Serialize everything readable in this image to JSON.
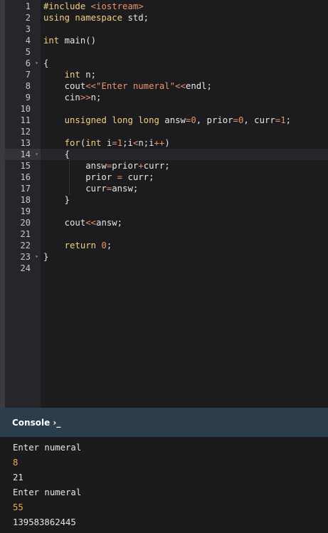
{
  "colors": {
    "keyword": "#f0d080",
    "type": "#f0d080",
    "preprocessor": "#f0d080",
    "include_target": "#e8956a",
    "operator": "#e8956a",
    "number": "#e8956a",
    "string": "#e8956a",
    "plain": "#e6e6e6",
    "console_input": "#e8b04a",
    "console_output": "#e6e6e6",
    "console_header_bg": "#2c3e4c"
  },
  "editor": {
    "active_line": 14,
    "fold_markers": [
      6,
      14,
      23
    ],
    "lines": [
      [
        [
          "preprocessor",
          "#include "
        ],
        [
          "include_target",
          "<iostream>"
        ]
      ],
      [
        [
          "keyword",
          "using namespace "
        ],
        [
          "plain",
          "std;"
        ]
      ],
      [],
      [
        [
          "type",
          "int "
        ],
        [
          "plain",
          "main()"
        ]
      ],
      [],
      [
        [
          "plain",
          "{"
        ]
      ],
      [
        [
          "plain",
          "    "
        ],
        [
          "type",
          "int "
        ],
        [
          "plain",
          "n;"
        ]
      ],
      [
        [
          "plain",
          "    cout"
        ],
        [
          "operator",
          "<<"
        ],
        [
          "string",
          "\"Enter numeral\""
        ],
        [
          "operator",
          "<<"
        ],
        [
          "plain",
          "endl;"
        ]
      ],
      [
        [
          "plain",
          "    cin"
        ],
        [
          "operator",
          ">>"
        ],
        [
          "plain",
          "n;"
        ]
      ],
      [],
      [
        [
          "plain",
          "    "
        ],
        [
          "type",
          "unsigned long long "
        ],
        [
          "plain",
          "answ"
        ],
        [
          "operator",
          "="
        ],
        [
          "number",
          "0"
        ],
        [
          "plain",
          ", prior"
        ],
        [
          "operator",
          "="
        ],
        [
          "number",
          "0"
        ],
        [
          "plain",
          ", curr"
        ],
        [
          "operator",
          "="
        ],
        [
          "number",
          "1"
        ],
        [
          "plain",
          ";"
        ]
      ],
      [],
      [
        [
          "plain",
          "    "
        ],
        [
          "keyword",
          "for"
        ],
        [
          "plain",
          "("
        ],
        [
          "type",
          "int "
        ],
        [
          "plain",
          "i"
        ],
        [
          "operator",
          "="
        ],
        [
          "number",
          "1"
        ],
        [
          "plain",
          ";i"
        ],
        [
          "operator",
          "<"
        ],
        [
          "plain",
          "n;i"
        ],
        [
          "operator",
          "++"
        ],
        [
          "plain",
          ")"
        ]
      ],
      [
        [
          "plain",
          "    {"
        ]
      ],
      [
        [
          "plain",
          "        answ"
        ],
        [
          "operator",
          "="
        ],
        [
          "plain",
          "prior"
        ],
        [
          "operator",
          "+"
        ],
        [
          "plain",
          "curr;"
        ]
      ],
      [
        [
          "plain",
          "        prior "
        ],
        [
          "operator",
          "="
        ],
        [
          "plain",
          " curr;"
        ]
      ],
      [
        [
          "plain",
          "        curr"
        ],
        [
          "operator",
          "="
        ],
        [
          "plain",
          "answ;"
        ]
      ],
      [
        [
          "plain",
          "    }"
        ]
      ],
      [],
      [
        [
          "plain",
          "    cout"
        ],
        [
          "operator",
          "<<"
        ],
        [
          "plain",
          "answ;"
        ]
      ],
      [],
      [
        [
          "plain",
          "    "
        ],
        [
          "keyword",
          "return "
        ],
        [
          "number",
          "0"
        ],
        [
          "plain",
          ";"
        ]
      ],
      [
        [
          "plain",
          "}"
        ]
      ],
      []
    ]
  },
  "console": {
    "title": "Console",
    "prompt_glyph": "›_",
    "lines": [
      {
        "text": "Enter numeral",
        "kind": "output"
      },
      {
        "text": "8",
        "kind": "input"
      },
      {
        "text": "21",
        "kind": "output"
      },
      {
        "text": "Enter numeral",
        "kind": "output"
      },
      {
        "text": "55",
        "kind": "input"
      },
      {
        "text": "139583862445",
        "kind": "output"
      }
    ]
  }
}
